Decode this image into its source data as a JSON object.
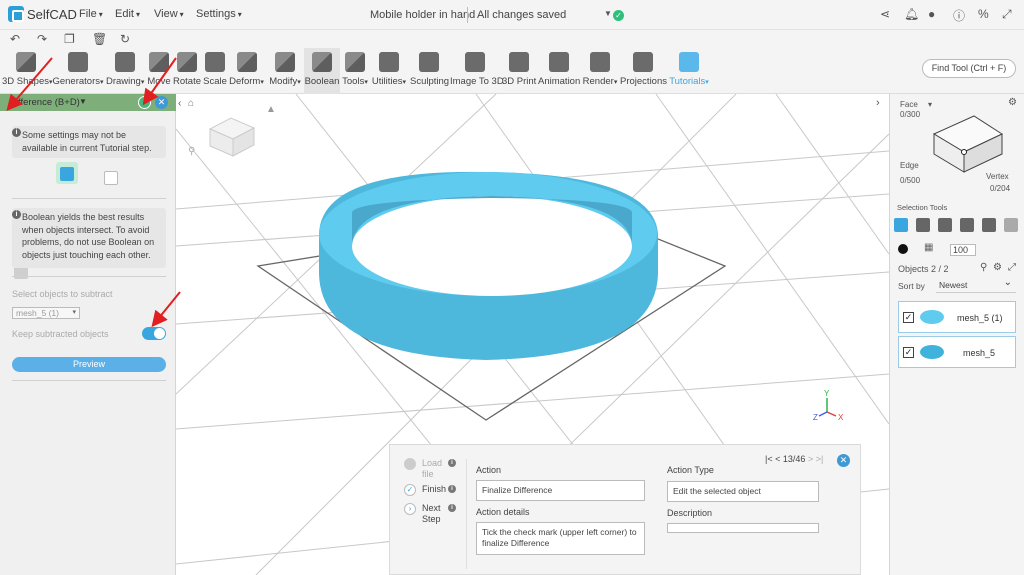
{
  "app": {
    "name": "SelfCAD",
    "menus": [
      "File",
      "Edit",
      "View",
      "Settings"
    ],
    "project_name": "Mobile holder in hand",
    "save_status": "All changes saved"
  },
  "toolbar": {
    "tools": [
      {
        "label": "3D Shapes",
        "dropdown": true,
        "icon": "3d-shapes-icon"
      },
      {
        "label": "Generators",
        "dropdown": true,
        "icon": "generators-icon"
      },
      {
        "label": "Drawing",
        "dropdown": true,
        "icon": "drawing-icon"
      },
      {
        "label": "Move",
        "dropdown": false,
        "icon": "move-icon"
      },
      {
        "label": "Rotate",
        "dropdown": false,
        "icon": "rotate-icon"
      },
      {
        "label": "Scale",
        "dropdown": false,
        "icon": "scale-icon"
      },
      {
        "label": "Deform",
        "dropdown": true,
        "icon": "deform-icon"
      },
      {
        "label": "Modify",
        "dropdown": true,
        "icon": "modify-icon"
      },
      {
        "label": "Boolean",
        "dropdown": false,
        "icon": "boolean-icon"
      },
      {
        "label": "Tools",
        "dropdown": true,
        "icon": "tools-icon"
      },
      {
        "label": "Utilities",
        "dropdown": true,
        "icon": "utilities-icon"
      },
      {
        "label": "Sculpting",
        "dropdown": false,
        "icon": "sculpting-icon"
      },
      {
        "label": "Image To 3D",
        "dropdown": false,
        "icon": "image-to-3d-icon"
      },
      {
        "label": "3D Print",
        "dropdown": false,
        "icon": "3d-print-icon"
      },
      {
        "label": "Animation",
        "dropdown": false,
        "icon": "animation-icon"
      },
      {
        "label": "Render",
        "dropdown": true,
        "icon": "render-icon"
      },
      {
        "label": "Projections",
        "dropdown": false,
        "icon": "projections-icon"
      },
      {
        "label": "Tutorials",
        "dropdown": true,
        "icon": "tutorials-icon"
      }
    ],
    "find_tool": "Find Tool (Ctrl + F)"
  },
  "left_panel": {
    "title": "Difference (B+D)",
    "info1": "Some settings may not be available in current Tutorial step.",
    "info2": "Boolean yields the best results when objects intersect. To avoid problems, do not use Boolean on objects just touching each other.",
    "select_label": "Select objects to subtract",
    "select_value": "mesh_5 (1)",
    "keep_label": "Keep subtracted objects",
    "keep_on": true,
    "preview": "Preview"
  },
  "right_panel": {
    "face_label": "Face",
    "face_count": "0/300",
    "edge_label": "Edge",
    "edge_count": "0/500",
    "vertex_label": "Vertex",
    "vertex_count": "0/204",
    "selection_tools": "Selection Tools",
    "brush_size": "100",
    "objects_label": "Objects 2 / 2",
    "sort_label": "Sort by",
    "sort_value": "Newest",
    "objects": [
      {
        "name": "mesh_5 (1)",
        "checked": true
      },
      {
        "name": "mesh_5",
        "checked": true
      }
    ]
  },
  "tutorial": {
    "steps": [
      {
        "label": "Load file",
        "state": "pending"
      },
      {
        "label": "Finish",
        "state": "done"
      },
      {
        "label": "Next Step",
        "state": "next"
      }
    ],
    "nav": "13/46",
    "action_label": "Action",
    "action_value": "Finalize Difference",
    "action_type_label": "Action Type",
    "action_type_value": "Edit the selected object",
    "details_label": "Action details",
    "details_value": "Tick the check mark (upper left corner) to finalize Difference",
    "description_label": "Description",
    "description_value": ""
  },
  "axis": {
    "x": "X",
    "y": "Y",
    "z": "Z"
  },
  "colors": {
    "accent": "#3aa6e0",
    "ring": "#56c7ec",
    "panel_header": "#7eaf7a",
    "annotation": "#e02020"
  }
}
